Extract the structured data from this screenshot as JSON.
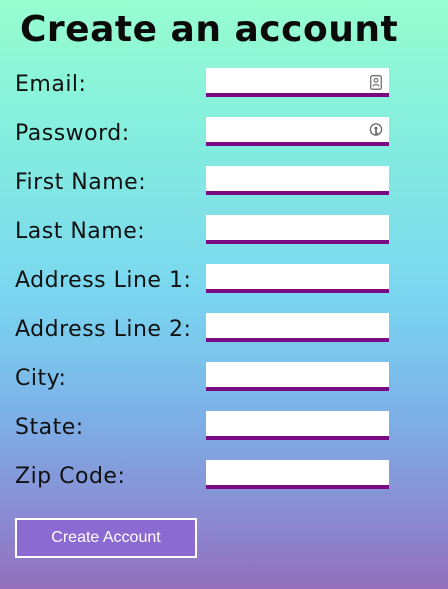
{
  "page": {
    "title": "Create an account"
  },
  "form": {
    "fields": [
      {
        "label": "Email:",
        "value": "",
        "icon": "contact-card-icon"
      },
      {
        "label": "Password:",
        "value": "",
        "icon": "password-key-icon"
      },
      {
        "label": "First Name:",
        "value": ""
      },
      {
        "label": "Last Name:",
        "value": ""
      },
      {
        "label": "Address Line 1:",
        "value": ""
      },
      {
        "label": "Address Line 2:",
        "value": ""
      },
      {
        "label": "City:",
        "value": ""
      },
      {
        "label": "State:",
        "value": ""
      },
      {
        "label": "Zip Code:",
        "value": ""
      }
    ],
    "submit_label": "Create Account"
  },
  "colors": {
    "input_underline": "#7a0a84",
    "button_fill": "#8b6ad2",
    "gradient_top": "#98fdd0",
    "gradient_bottom": "#9270bb"
  }
}
